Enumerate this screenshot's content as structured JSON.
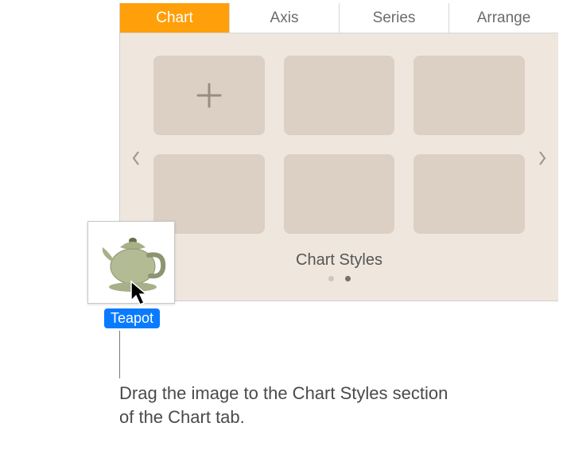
{
  "tabs": {
    "chart": "Chart",
    "axis": "Axis",
    "series": "Series",
    "arrange": "Arrange"
  },
  "styles": {
    "label": "Chart Styles"
  },
  "drag": {
    "filename": "Teapot"
  },
  "callout": {
    "text": "Drag the image to the Chart Styles section of the Chart tab."
  }
}
